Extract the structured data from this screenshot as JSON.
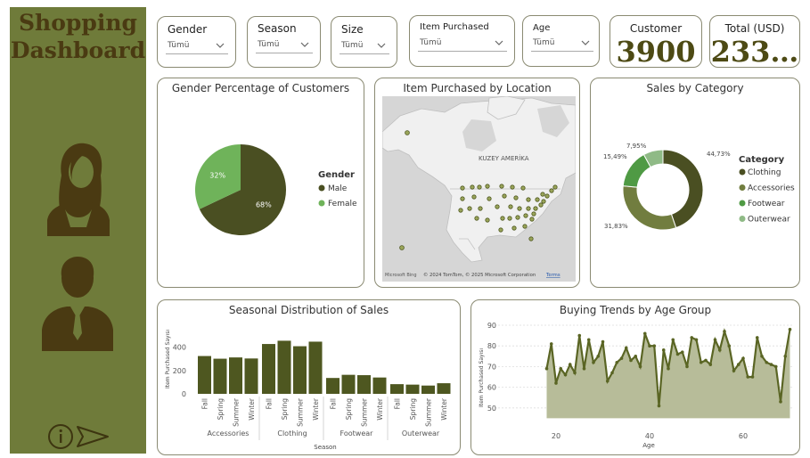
{
  "sidebar": {
    "title_line1": "Shopping",
    "title_line2": "Dashboard"
  },
  "filters": [
    {
      "label": "Gender",
      "value": "Tümü"
    },
    {
      "label": "Season",
      "value": "Tümü"
    },
    {
      "label": "Size",
      "value": "Tümü"
    },
    {
      "label": "Item Purchased",
      "value": "Tümü"
    },
    {
      "label": "Age",
      "value": "Tümü"
    }
  ],
  "kpis": [
    {
      "label": "Customer",
      "value": "3900"
    },
    {
      "label": "Total (USD)",
      "value": "233…"
    }
  ],
  "gender_chart": {
    "title": "Gender Percentage of Customers",
    "legend_title": "Gender",
    "chart_data": {
      "type": "pie",
      "categories": [
        "Male",
        "Female"
      ],
      "values": [
        68,
        32
      ],
      "labels": [
        "68%",
        "32%"
      ],
      "colors": [
        "#4a4f22",
        "#6fb35a"
      ]
    }
  },
  "map_card": {
    "title": "Item Purchased by Location",
    "region_label": "KUZEY AMERİKA",
    "attribution": "© 2024 TomTom, © 2025 Microsoft Corporation",
    "bing": "Microsoft Bing",
    "terms": "Terms"
  },
  "category_chart": {
    "title": "Sales by Category",
    "legend_title": "Category",
    "chart_data": {
      "type": "pie",
      "categories": [
        "Clothing",
        "Accessories",
        "Footwear",
        "Outerwear"
      ],
      "values": [
        44.73,
        31.83,
        15.49,
        7.95
      ],
      "labels": [
        "44,73%",
        "31,83%",
        "15,49%",
        "7,95%"
      ],
      "colors": [
        "#4a4f22",
        "#717d3f",
        "#4f9a44",
        "#8fba86"
      ]
    }
  },
  "seasonal_chart": {
    "title": "Seasonal Distribution of Sales",
    "xlabel": "Season",
    "ylabel": "Item Purchased Sayısı",
    "chart_data": {
      "type": "bar",
      "groups": [
        "Accessories",
        "Clothing",
        "Footwear",
        "Outerwear"
      ],
      "seasons": [
        "Fall",
        "Spring",
        "Summer",
        "Winter"
      ],
      "values": [
        [
          324,
          301,
          312,
          303
        ],
        [
          427,
          455,
          408,
          447
        ],
        [
          136,
          163,
          160,
          140
        ],
        [
          83,
          79,
          71,
          91
        ]
      ],
      "yticks": [
        0,
        200,
        400
      ],
      "ylim": [
        0,
        480
      ],
      "color": "#4e5720"
    }
  },
  "age_chart": {
    "title": "Buying Trends by Age Group",
    "xlabel": "Age",
    "ylabel": "Item Purchased Sayısı",
    "chart_data": {
      "type": "area",
      "x": [
        18,
        19,
        20,
        21,
        22,
        23,
        24,
        25,
        26,
        27,
        28,
        29,
        30,
        31,
        32,
        33,
        34,
        35,
        36,
        37,
        38,
        39,
        40,
        41,
        42,
        43,
        44,
        45,
        46,
        47,
        48,
        49,
        50,
        51,
        52,
        53,
        54,
        55,
        56,
        57,
        58,
        59,
        60,
        61,
        62,
        63,
        64,
        65,
        66,
        67,
        68,
        69,
        70
      ],
      "y": [
        69,
        81,
        62,
        69,
        66,
        71,
        67,
        85,
        69,
        83,
        72,
        75,
        82,
        63,
        67,
        72,
        74,
        79,
        73,
        75,
        70,
        86,
        80,
        80,
        51,
        78,
        69,
        83,
        76,
        77,
        70,
        84,
        83,
        72,
        73,
        71,
        83,
        78,
        87,
        80,
        68,
        71,
        74,
        65,
        65,
        84,
        75,
        72,
        71,
        70,
        53,
        75,
        88
      ],
      "xticks": [
        20,
        40,
        60
      ],
      "yticks": [
        50,
        60,
        70,
        80,
        90
      ],
      "ylim": [
        45,
        90
      ],
      "color": "#5a6524",
      "fill": "#b7bc99"
    }
  }
}
